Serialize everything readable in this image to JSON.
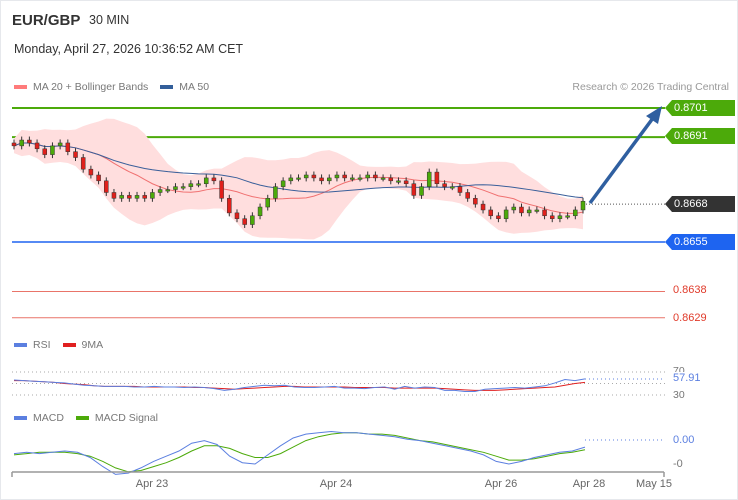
{
  "header": {
    "symbol": "EUR/GBP",
    "timeframe": "30 MIN",
    "datetime": "Monday, April 27, 2026 10:36:52 AM CET"
  },
  "legend": {
    "ma20": "MA 20 + Bollinger Bands",
    "ma50": "MA 50",
    "credit": "Research © 2026 Trading Central"
  },
  "levels": [
    {
      "label": "0.8701",
      "value": 0.8701,
      "color": "#4caa0a",
      "style": "tag"
    },
    {
      "label": "0.8691",
      "value": 0.8691,
      "color": "#4caa0a",
      "style": "tag"
    },
    {
      "label": "0.8668",
      "value": 0.8668,
      "color": "#333333",
      "style": "tag"
    },
    {
      "label": "0.8655",
      "value": 0.8655,
      "color": "#1e64f0",
      "style": "tag"
    },
    {
      "label": "0.8638",
      "value": 0.8638,
      "color": "#e03a2a",
      "style": "text"
    },
    {
      "label": "0.8629",
      "value": 0.8629,
      "color": "#e03a2a",
      "style": "text"
    }
  ],
  "rsi": {
    "label": "RSI",
    "ma_label": "9MA",
    "value": "57.91",
    "upper": "70",
    "lower": "30"
  },
  "macd": {
    "label": "MACD",
    "signal_label": "MACD Signal",
    "value": "0.00",
    "lower": "-0"
  },
  "xaxis": [
    "Apr 23",
    "Apr 24",
    "Apr 26",
    "Apr 28",
    "May 15"
  ],
  "colors": {
    "up": "#4caa0a",
    "down": "#e0201b",
    "band": "#ffdede",
    "ma20": "#f07070",
    "ma50": "#3a5f9a",
    "arrow": "#2f5fa0"
  },
  "chart_data": {
    "type": "candlestick",
    "closes": [
      0.8688,
      0.869,
      0.8689,
      0.8687,
      0.8685,
      0.8688,
      0.8689,
      0.8686,
      0.8684,
      0.868,
      0.8678,
      0.8676,
      0.8672,
      0.867,
      0.8671,
      0.867,
      0.8671,
      0.867,
      0.8672,
      0.8673,
      0.8673,
      0.8674,
      0.8674,
      0.8675,
      0.8675,
      0.8677,
      0.8676,
      0.867,
      0.8665,
      0.8663,
      0.8661,
      0.8664,
      0.8667,
      0.867,
      0.8674,
      0.8676,
      0.8677,
      0.8677,
      0.8678,
      0.8677,
      0.8676,
      0.8677,
      0.8678,
      0.8677,
      0.8677,
      0.8677,
      0.8678,
      0.8677,
      0.8677,
      0.8676,
      0.8676,
      0.8675,
      0.8671,
      0.8674,
      0.8679,
      0.8675,
      0.8674,
      0.8674,
      0.8672,
      0.867,
      0.8668,
      0.8666,
      0.8664,
      0.8663,
      0.8666,
      0.8667,
      0.8665,
      0.8666,
      0.8666,
      0.8664,
      0.8663,
      0.8664,
      0.8664,
      0.8666,
      0.8669
    ],
    "rsi": [
      56,
      55,
      54,
      53,
      52,
      51,
      49,
      47,
      46,
      45,
      45,
      45,
      44,
      44,
      45,
      44,
      44,
      43,
      44,
      43,
      41,
      38,
      40,
      43,
      45,
      47,
      46,
      47,
      44,
      43,
      43,
      44,
      45,
      42,
      42,
      41,
      43,
      44,
      40,
      45,
      42,
      44,
      43,
      38,
      38,
      36,
      36,
      40,
      41,
      42,
      43,
      42,
      44,
      46,
      51,
      57,
      55,
      58
    ],
    "rsi_ma": [
      55,
      55,
      54,
      53,
      52,
      50,
      49,
      48,
      46,
      45,
      45,
      45,
      45,
      44,
      44,
      44,
      44,
      44,
      43,
      43,
      42,
      41,
      40,
      41,
      42,
      43,
      44,
      45,
      45,
      44,
      44,
      44,
      44,
      44,
      43,
      43,
      43,
      43,
      42,
      42,
      42,
      42,
      42,
      41,
      40,
      39,
      38,
      38,
      38,
      39,
      40,
      41,
      42,
      43,
      44,
      47,
      50,
      52
    ],
    "macd": [
      -2,
      -1,
      -2,
      -1,
      0,
      -1,
      -5,
      -12,
      -18,
      -17,
      -13,
      -8,
      -4,
      0,
      6,
      8,
      5,
      -4,
      -9,
      -10,
      -3,
      4,
      10,
      13,
      14,
      15,
      14,
      14,
      13,
      12,
      11,
      9,
      8,
      6,
      4,
      2,
      0,
      -3,
      -8,
      -10,
      -8,
      -5,
      -3,
      -1,
      0,
      3
    ],
    "macd_signal": [
      -3,
      -2,
      -1,
      -1,
      -1,
      -2,
      -4,
      -8,
      -13,
      -16,
      -15,
      -12,
      -9,
      -5,
      0,
      4,
      4,
      2,
      -2,
      -5,
      -5,
      -2,
      3,
      8,
      11,
      13,
      14,
      14,
      13,
      13,
      12,
      10,
      8,
      7,
      5,
      3,
      1,
      -1,
      -4,
      -7,
      -7,
      -6,
      -4,
      -2,
      -1,
      1
    ]
  }
}
